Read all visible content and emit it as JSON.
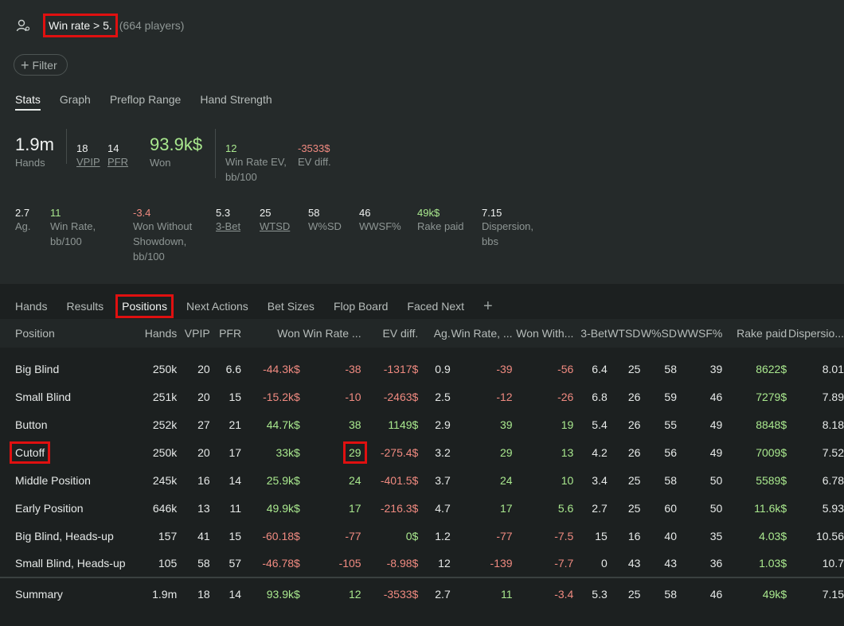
{
  "filter": {
    "chip_label": "Win rate > 5.",
    "players": "(664 players)",
    "add_filter_label": "Filter"
  },
  "stat_tabs": [
    "Stats",
    "Graph",
    "Preflop Range",
    "Hand Strength"
  ],
  "summary_stats": {
    "hands": {
      "value": "1.9m",
      "label": "Hands"
    },
    "vpip": {
      "value": "18",
      "label": "VPIP"
    },
    "pfr": {
      "value": "14",
      "label": "PFR"
    },
    "won": {
      "value": "93.9k$",
      "label": "Won"
    },
    "win_rate_ev": {
      "value": "12",
      "label_1": "Win Rate EV,",
      "label_2": "bb/100"
    },
    "ev_diff": {
      "value": "-3533$",
      "label": "EV diff."
    }
  },
  "extra_stats": {
    "ag": {
      "value": "2.7",
      "label": "Ag."
    },
    "win_rate": {
      "value": "11",
      "label_1": "Win Rate,",
      "label_2": "bb/100"
    },
    "won_without_sd": {
      "value": "-3.4",
      "label_1": "Won Without",
      "label_2": "Showdown,",
      "label_3": "bb/100"
    },
    "three_bet": {
      "value": "5.3",
      "label": "3-Bet"
    },
    "wtsd": {
      "value": "25",
      "label": "WTSD"
    },
    "wsd": {
      "value": "58",
      "label": "W%SD"
    },
    "wwsf": {
      "value": "46",
      "label": "WWSF%"
    },
    "rake": {
      "value": "49k$",
      "label": "Rake paid"
    },
    "dispersion": {
      "value": "7.15",
      "label_1": "Dispersion,",
      "label_2": "bbs"
    }
  },
  "report_tabs": [
    "Hands",
    "Results",
    "Positions",
    "Next Actions",
    "Bet Sizes",
    "Flop Board",
    "Faced Next"
  ],
  "columns": [
    "Position",
    "Hands",
    "VPIP",
    "PFR",
    "Won",
    "Win Rate ...",
    "EV diff.",
    "Ag.",
    "Win Rate, ...",
    "Won With...",
    "3-Bet",
    "WTSD",
    "W%SD",
    "WWSF%",
    "Rake paid",
    "Dispersio..."
  ],
  "rows": [
    [
      "Big Blind",
      "250k",
      "20",
      "6.6",
      "-44.3k$",
      "-38",
      "-1317$",
      "0.9",
      "-39",
      "-56",
      "6.4",
      "25",
      "58",
      "39",
      "8622$",
      "8.01"
    ],
    [
      "Small Blind",
      "251k",
      "20",
      "15",
      "-15.2k$",
      "-10",
      "-2463$",
      "2.5",
      "-12",
      "-26",
      "6.8",
      "26",
      "59",
      "46",
      "7279$",
      "7.89"
    ],
    [
      "Button",
      "252k",
      "27",
      "21",
      "44.7k$",
      "38",
      "1149$",
      "2.9",
      "39",
      "19",
      "5.4",
      "26",
      "55",
      "49",
      "8848$",
      "8.18"
    ],
    [
      "Cutoff",
      "250k",
      "20",
      "17",
      "33k$",
      "29",
      "-275.4$",
      "3.2",
      "29",
      "13",
      "4.2",
      "26",
      "56",
      "49",
      "7009$",
      "7.52"
    ],
    [
      "Middle Position",
      "245k",
      "16",
      "14",
      "25.9k$",
      "24",
      "-401.5$",
      "3.7",
      "24",
      "10",
      "3.4",
      "25",
      "58",
      "50",
      "5589$",
      "6.78"
    ],
    [
      "Early Position",
      "646k",
      "13",
      "11",
      "49.9k$",
      "17",
      "-216.3$",
      "4.7",
      "17",
      "5.6",
      "2.7",
      "25",
      "60",
      "50",
      "11.6k$",
      "5.93"
    ],
    [
      "Big Blind, Heads-up",
      "157",
      "41",
      "15",
      "-60.18$",
      "-77",
      "0$",
      "1.2",
      "-77",
      "-7.5",
      "15",
      "16",
      "40",
      "35",
      "4.03$",
      "10.56"
    ],
    [
      "Small Blind, Heads-up",
      "105",
      "58",
      "57",
      "-46.78$",
      "-105",
      "-8.98$",
      "12",
      "-139",
      "-7.7",
      "0",
      "43",
      "43",
      "36",
      "1.03$",
      "10.7"
    ]
  ],
  "summary_row": [
    "Summary",
    "1.9m",
    "18",
    "14",
    "93.9k$",
    "12",
    "-3533$",
    "2.7",
    "11",
    "-3.4",
    "5.3",
    "25",
    "58",
    "46",
    "49k$",
    "7.15"
  ],
  "colors": {
    "positive": "#a9e88e",
    "negative": "#f08a80",
    "highlight": "#e01010"
  }
}
